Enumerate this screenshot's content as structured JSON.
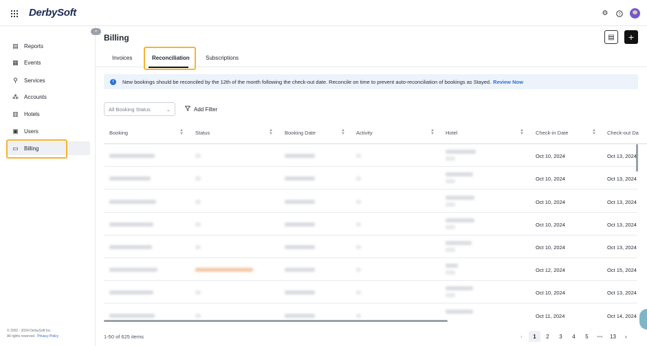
{
  "app": {
    "logo_text": "DerbySoft"
  },
  "topbar": {
    "icons": [
      "grid-icon",
      "gear-icon",
      "help-icon",
      "avatar"
    ]
  },
  "sidebar": {
    "items": [
      {
        "label": "Reports",
        "icon": "reports-icon"
      },
      {
        "label": "Events",
        "icon": "events-icon"
      },
      {
        "label": "Services",
        "icon": "services-icon"
      },
      {
        "label": "Accounts",
        "icon": "accounts-icon"
      },
      {
        "label": "Hotels",
        "icon": "hotels-icon"
      },
      {
        "label": "Users",
        "icon": "users-icon"
      },
      {
        "label": "Billing",
        "icon": "billing-icon",
        "active": true
      }
    ],
    "footer_copyright": "© 2002 - 2024 DerbySoft Inc.",
    "footer_rights": "All rights reserved.",
    "footer_link": "Privacy Policy"
  },
  "page": {
    "title": "Billing"
  },
  "tabs": [
    {
      "label": "Invoices"
    },
    {
      "label": "Reconciliation",
      "active": true
    },
    {
      "label": "Subscriptions"
    }
  ],
  "banner": {
    "message": "New bookings should be reconciled by the 12th of the month following the check-out date. Reconcile on time to prevent auto-reconciliation of bookings as Stayed.",
    "link": "Review Now"
  },
  "filters": {
    "status_placeholder": "All Booking Status",
    "add_filter": "Add Filter"
  },
  "table": {
    "columns": [
      "Booking",
      "Status",
      "Booking Date",
      "Activity",
      "Hotel",
      "Check-in Date",
      "Check-out Da"
    ],
    "rows": [
      {
        "checkin": "Oct 10, 2024",
        "checkout": "Oct 13, 2024"
      },
      {
        "checkin": "Oct 10, 2024",
        "checkout": "Oct 13, 2024"
      },
      {
        "checkin": "Oct 10, 2024",
        "checkout": "Oct 13, 2024"
      },
      {
        "checkin": "Oct 10, 2024",
        "checkout": "Oct 13, 2024"
      },
      {
        "checkin": "Oct 10, 2024",
        "checkout": "Oct 13, 2024"
      },
      {
        "checkin": "Oct 12, 2024",
        "checkout": "Oct 15, 2024"
      },
      {
        "checkin": "Oct 10, 2024",
        "checkout": "Oct 13, 2024"
      },
      {
        "checkin": "Oct 11, 2024",
        "checkout": "Oct 14, 2024"
      }
    ]
  },
  "pagination": {
    "summary": "1-50 of 625 items",
    "prev": "‹",
    "pages": [
      "1",
      "2",
      "3",
      "4",
      "5"
    ],
    "ellipsis": "•••",
    "last": "13",
    "next": "›",
    "current": "1"
  }
}
